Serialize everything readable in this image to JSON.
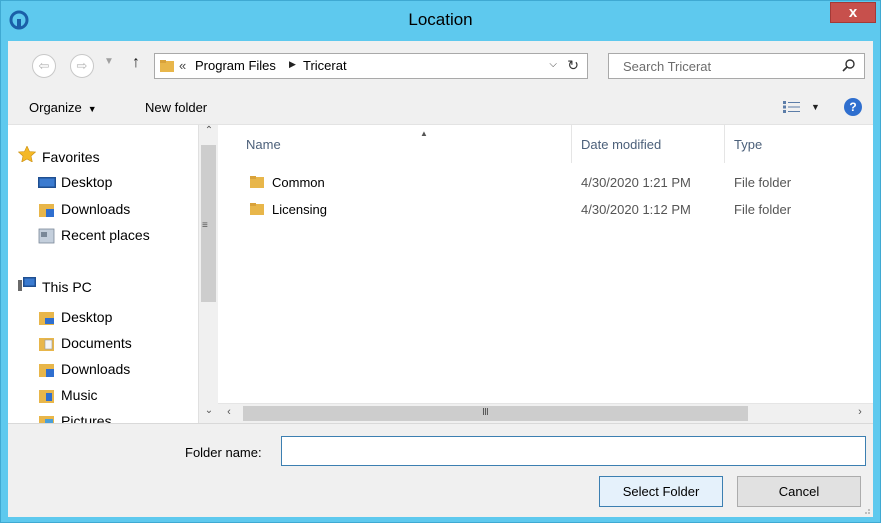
{
  "window": {
    "title": "Location",
    "close_label": "x"
  },
  "nav": {
    "back_icon": "back-arrow",
    "forward_icon": "forward-arrow",
    "up_icon": "up-arrow",
    "up_glyph": "↑",
    "breadcrumb_prefix": "«",
    "breadcrumb": [
      "Program Files",
      "Tricerat"
    ],
    "search_placeholder": "Search Tricerat"
  },
  "toolbar": {
    "organize_label": "Organize",
    "new_folder_label": "New folder"
  },
  "sidebar": {
    "favorites": {
      "label": "Favorites",
      "items": [
        {
          "label": "Desktop",
          "icon": "desktop-icon"
        },
        {
          "label": "Downloads",
          "icon": "downloads-folder-icon"
        },
        {
          "label": "Recent places",
          "icon": "recent-places-icon"
        }
      ]
    },
    "this_pc": {
      "label": "This PC",
      "items": [
        {
          "label": "Desktop",
          "icon": "desktop-folder-icon"
        },
        {
          "label": "Documents",
          "icon": "documents-folder-icon"
        },
        {
          "label": "Downloads",
          "icon": "downloads-folder-icon"
        },
        {
          "label": "Music",
          "icon": "music-folder-icon"
        },
        {
          "label": "Pictures",
          "icon": "pictures-folder-icon"
        }
      ]
    }
  },
  "file_list": {
    "columns": [
      "Name",
      "Date modified",
      "Type"
    ],
    "rows": [
      {
        "name": "Common",
        "date": "4/30/2020 1:21 PM",
        "type": "File folder"
      },
      {
        "name": "Licensing",
        "date": "4/30/2020 1:12 PM",
        "type": "File folder"
      }
    ]
  },
  "bottom": {
    "folder_name_label": "Folder name:",
    "folder_name_value": "",
    "select_button": "Select Folder",
    "cancel_button": "Cancel"
  },
  "colors": {
    "frame": "#5ec9ee",
    "close": "#c7504c",
    "folder": "#e8b64a",
    "accent": "#3c7fb1"
  }
}
